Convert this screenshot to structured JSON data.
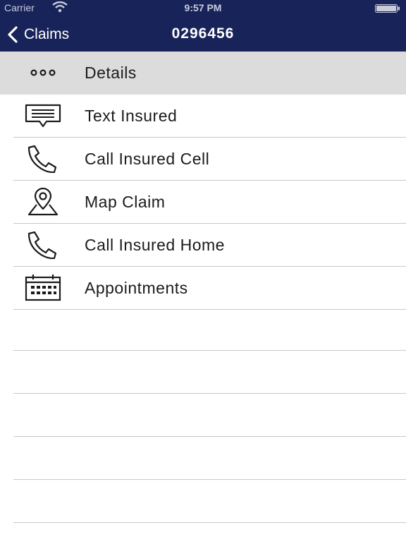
{
  "status_bar": {
    "carrier": "Carrier",
    "time": "9:57 PM"
  },
  "nav": {
    "back_label": "Claims",
    "title": "0296456"
  },
  "details": {
    "label": "Details",
    "icon": "more-dots-icon"
  },
  "menu": {
    "items": [
      {
        "label": "Text Insured",
        "icon": "message-icon"
      },
      {
        "label": "Call Insured Cell",
        "icon": "phone-icon"
      },
      {
        "label": "Map Claim",
        "icon": "map-pin-icon"
      },
      {
        "label": "Call Insured Home",
        "icon": "phone-icon"
      },
      {
        "label": "Appointments",
        "icon": "calendar-icon"
      }
    ]
  },
  "colors": {
    "header_bg": "#18235a",
    "selected_row_bg": "#dcdcdc",
    "separator": "#c8c8c8"
  }
}
